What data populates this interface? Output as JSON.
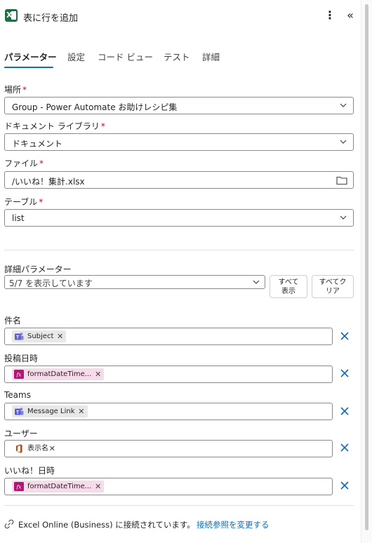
{
  "header": {
    "app_icon_name": "excel-icon",
    "app_icon_letter": "X",
    "title": "表に行を追加",
    "more_glyph": "⋮",
    "collapse_glyph": "«"
  },
  "tabs": [
    {
      "label": "パラメーター",
      "active": true
    },
    {
      "label": "設定",
      "active": false
    },
    {
      "label": "コード ビュー",
      "active": false
    },
    {
      "label": "テスト",
      "active": false
    },
    {
      "label": "詳細",
      "active": false
    }
  ],
  "fields": {
    "location": {
      "label": "場所",
      "required": "*",
      "value": "Group - Power Automate お助けレシピ集"
    },
    "document_library": {
      "label": "ドキュメント ライブラリ",
      "required": "*",
      "value": "ドキュメント"
    },
    "file": {
      "label": "ファイル",
      "required": "*",
      "value": "/いいね！集計.xlsx"
    },
    "table": {
      "label": "テーブル",
      "required": "*",
      "value": "list"
    }
  },
  "advanced": {
    "label": "詳細パラメーター",
    "select_value": "5/7 を表示しています",
    "show_all_line1": "すべて",
    "show_all_line2": "表示",
    "clear_all_line1": "すべてク",
    "clear_all_line2": "リア"
  },
  "params": [
    {
      "label": "件名",
      "token": "Subject",
      "token_type": "teams",
      "remove": "✕"
    },
    {
      "label": "投稿日時",
      "token": "formatDateTime...",
      "token_type": "fx",
      "remove": "✕"
    },
    {
      "label": "Teams",
      "token": "Message Link",
      "token_type": "teams",
      "remove": "✕"
    },
    {
      "label": "ユーザー",
      "token": "表示名",
      "token_type": "office",
      "remove": "✕"
    },
    {
      "label": "いいね！日時",
      "token": "formatDateTime...",
      "token_type": "fx",
      "remove": "✕"
    }
  ],
  "footer": {
    "connection_text": "Excel Online (Business) に接続されています。",
    "change_link": "接続参照を変更する"
  },
  "colors": {
    "accent": "#0f6cbd",
    "excel_green": "#1d7044",
    "required_red": "#c50f1f",
    "fx_token_bg": "#f8dbea",
    "fx_icon": "#b4137a",
    "teams_purple": "#5b5fc7",
    "office_orange": "#d83b01"
  }
}
